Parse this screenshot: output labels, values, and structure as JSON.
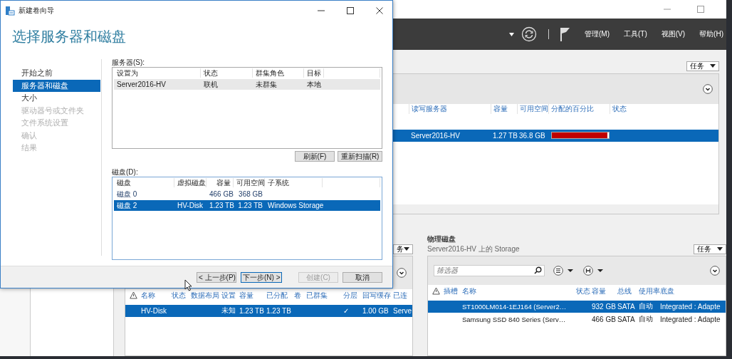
{
  "window": {
    "menus": [
      "管理(M)",
      "工具(T)",
      "视图(V)",
      "帮助(H)"
    ]
  },
  "storage_pools": {
    "tasks": "任务",
    "columns": [
      "读写服务器",
      "容量",
      "可用空间",
      "分配的百分比",
      "状态"
    ],
    "rows": [
      {
        "selected": true,
        "cells": [
          "Server2016-HV",
          "1.27 TB",
          "36.8 GB"
        ],
        "level": 0.97
      }
    ]
  },
  "virtual_disks": {
    "tasks": "务",
    "columns": [
      "名称",
      "状态",
      "数据布局",
      "设置",
      "容量",
      "已分配",
      "卷",
      "已群集",
      "分层",
      "回写缓存",
      "已连"
    ],
    "rows": [
      {
        "selected": true,
        "cells": [
          "HV-Disk",
          null,
          null,
          "未知",
          "1.23 TB",
          "1.23 TB",
          null,
          null,
          "✓",
          "1.00 GB",
          "Serve"
        ]
      }
    ]
  },
  "physical_disks": {
    "title": "物理磁盘",
    "subtitle": "Server2016-HV 上的 Storage",
    "tasks": "任务",
    "filter": {
      "placeholder": "筛选器"
    },
    "columns": [
      "插槽",
      "名称",
      "状态",
      "容量",
      "总线",
      "使用率",
      "底盘"
    ],
    "rows": [
      {
        "selected": true,
        "cells": [
          null,
          "ST1000LM014-1EJ164 (Server2…",
          null,
          "932 GB",
          "SATA",
          "自动",
          "Integrated : Adapte"
        ]
      },
      {
        "selected": false,
        "cells": [
          null,
          "Samsung SSD 840 Series (Serv…",
          null,
          "466 GB",
          "SATA",
          "自动",
          "Integrated : Adapte"
        ]
      }
    ]
  },
  "dialog": {
    "title": "新建卷向导",
    "heading": "选择服务器和磁盘",
    "steps": [
      {
        "label": "开始之前",
        "selected": false,
        "disabled": false
      },
      {
        "label": "服务器和磁盘",
        "selected": true,
        "disabled": false
      },
      {
        "label": "大小",
        "selected": false,
        "disabled": false
      },
      {
        "label": "驱动器号或文件夹",
        "selected": false,
        "disabled": true
      },
      {
        "label": "文件系统设置",
        "selected": false,
        "disabled": true
      },
      {
        "label": "确认",
        "selected": false,
        "disabled": true
      },
      {
        "label": "结果",
        "selected": false,
        "disabled": true
      }
    ],
    "servers": {
      "label": "服务器(S):",
      "columns": [
        "设置为",
        "状态",
        "群集角色",
        "目标"
      ],
      "rows": [
        {
          "selected": true,
          "cells": [
            "Server2016-HV",
            "联机",
            "未群集",
            "本地"
          ]
        }
      ]
    },
    "list_buttons": [
      "刷新(F)",
      "重新扫描(R)"
    ],
    "disks": {
      "label": "磁盘(D):",
      "columns": [
        "磁盘",
        "虚拟磁盘",
        "容量",
        "可用空间",
        "子系统"
      ],
      "rows": [
        {
          "selected": false,
          "cells": [
            "磁盘 0",
            null,
            "466 GB",
            "368 GB",
            null
          ]
        },
        {
          "selected": true,
          "cells": [
            "磁盘 2",
            "HV-Disk",
            "1.23 TB",
            "1.23 TB",
            "Windows Storage"
          ]
        }
      ]
    },
    "buttons": [
      {
        "label": "< 上一步(P)",
        "kind": "normal",
        "disabled": false
      },
      {
        "label": "下一步(N) >",
        "kind": "default",
        "disabled": false
      },
      {
        "label": "创建(C)",
        "kind": "normal",
        "disabled": true
      },
      {
        "label": "取消",
        "kind": "normal",
        "disabled": false
      }
    ]
  }
}
